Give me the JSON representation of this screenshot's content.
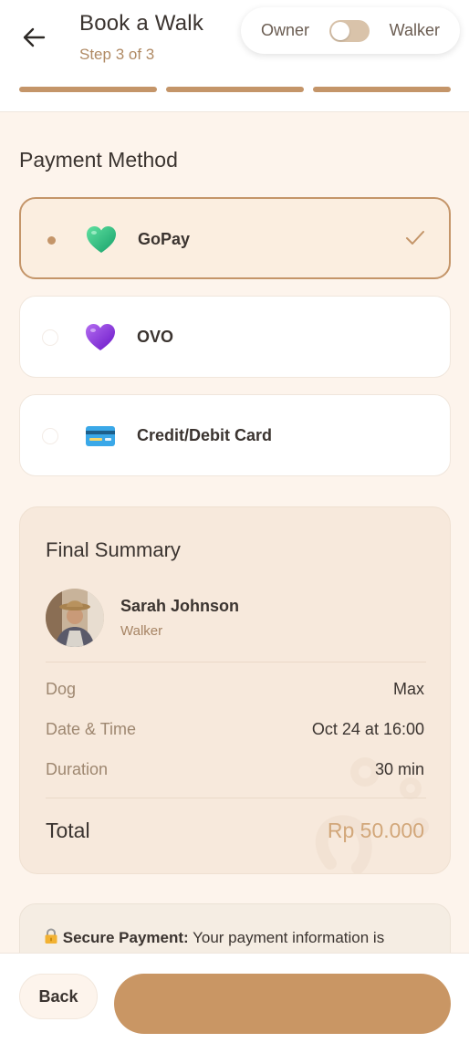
{
  "header": {
    "title": "Book a Walk",
    "step": "Step 3 of 3",
    "role_toggle": {
      "left_label": "Owner",
      "right_label": "Walker",
      "active": "Owner"
    },
    "progress_steps": 3,
    "progress_completed": 3
  },
  "payment": {
    "section_title": "Payment Method",
    "options": [
      {
        "label": "GoPay",
        "icon": "green-heart-icon",
        "selected": true
      },
      {
        "label": "OVO",
        "icon": "purple-heart-icon",
        "selected": false
      },
      {
        "label": "Credit/Debit Card",
        "icon": "credit-card-icon",
        "selected": false
      }
    ]
  },
  "summary": {
    "title": "Final Summary",
    "walker": {
      "name": "Sarah Johnson",
      "role": "Walker"
    },
    "rows": [
      {
        "label": "Dog",
        "value": "Max"
      },
      {
        "label": "Date & Time",
        "value": "Oct 24 at 16:00"
      },
      {
        "label": "Duration",
        "value": "30 min"
      }
    ],
    "total_label": "Total",
    "total_value": "Rp 50.000"
  },
  "secure": {
    "icon": "lock-icon",
    "bold": "Secure Payment:",
    "text": " Your payment information is"
  },
  "footer": {
    "back_label": "Back",
    "confirm_label": ""
  },
  "colors": {
    "accent": "#c49569",
    "background": "#fdf4ec",
    "total": "#d2a77a"
  }
}
